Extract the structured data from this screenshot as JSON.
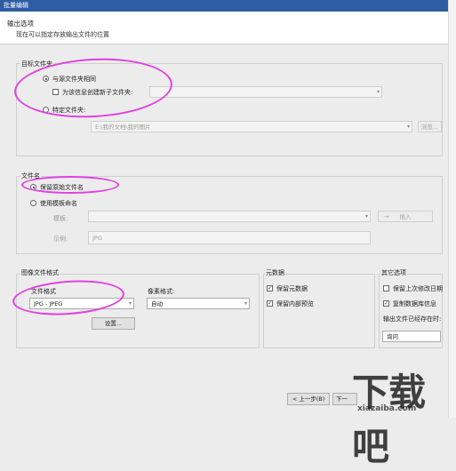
{
  "window": {
    "title": "批量编辑"
  },
  "header": {
    "title": "输出选项",
    "subtitle": "现在可以指定存放输出文件的位置"
  },
  "target_folder": {
    "group_label": "目标文件夹",
    "same_as_source": "与源文件夹相同",
    "create_subfolder": "为该信息创建新子文件夹:",
    "specific_folder": "特定文件夹:",
    "folder_path": "E:\\我的文档\\我的图片",
    "browse_label": "浏览..."
  },
  "file_name": {
    "group_label": "文件名",
    "keep_original": "保留原始文件名",
    "use_template": "使用模板命名",
    "template_label": "模板:",
    "insert_label": "插入",
    "example_label": "示例:",
    "example_value": "JPG"
  },
  "image_format": {
    "group_label": "图像文件格式",
    "file_format_label": "文件格式",
    "file_format_value": "JPG - JPEG",
    "pixel_format_label": "像素格式:",
    "pixel_format_value": "自动",
    "settings_label": "设置..."
  },
  "metadata": {
    "group_label": "元数据",
    "keep_metadata": "保留元数据",
    "keep_internal_preview": "保留内部预览"
  },
  "other_options": {
    "group_label": "其它选项",
    "keep_last_modified": "保留上次修改日期",
    "copy_database_info": "复制数据库信息",
    "if_exists_label": "输出文件已经存在时:",
    "if_exists_value": "询问"
  },
  "footer": {
    "back_label": "< 上一步(B)",
    "next_label": "下一"
  },
  "watermark": {
    "text": "下载吧",
    "suffix": "xiazaiba.com"
  },
  "colors": {
    "titlebar": "#2d5ea3",
    "annotation": "#e040e0"
  }
}
